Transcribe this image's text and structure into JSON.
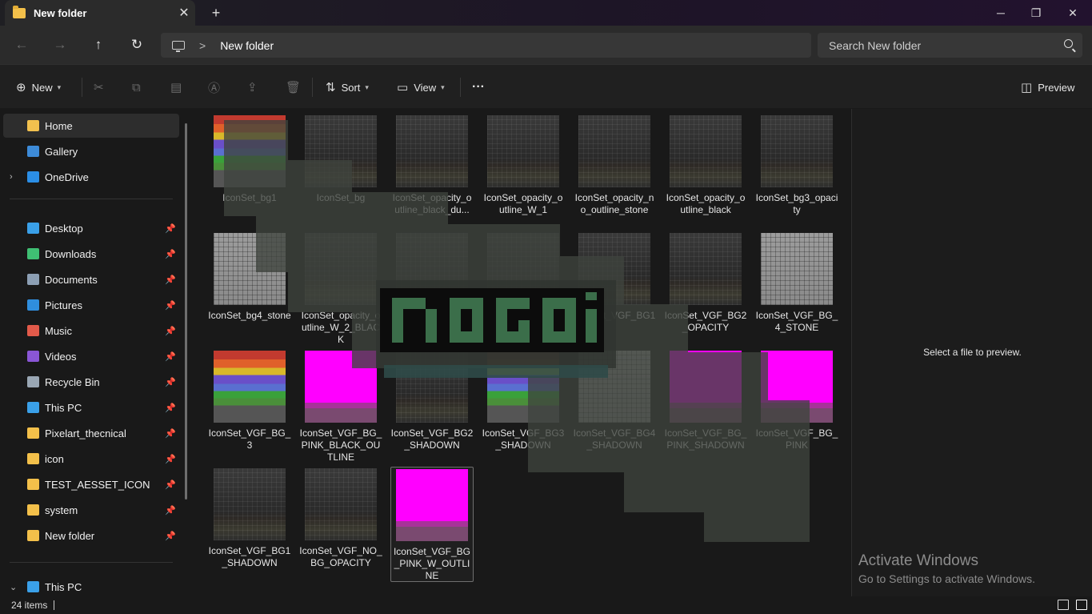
{
  "window": {
    "tab_title": "New folder",
    "tab_close": "✕",
    "new_tab": "+",
    "minimize": "─",
    "maximize": "❐",
    "close": "✕"
  },
  "nav": {
    "back": "←",
    "forward": "→",
    "up": "↑",
    "refresh": "↻",
    "separator": ">",
    "breadcrumb": "New folder",
    "search_placeholder": "Search New folder"
  },
  "toolbar": {
    "new_label": "New",
    "sort_label": "Sort",
    "view_label": "View",
    "more": "···",
    "preview_label": "Preview"
  },
  "sidebar": {
    "items": [
      {
        "label": "Home",
        "icon": "home-icon",
        "color": "#f2c14e"
      },
      {
        "label": "Gallery",
        "icon": "gallery-icon",
        "color": "#3d8bd8"
      },
      {
        "label": "OneDrive",
        "icon": "cloud-icon",
        "color": "#2b8ee6"
      },
      {
        "label": "Desktop",
        "icon": "desktop-icon",
        "color": "#3aa0e8"
      },
      {
        "label": "Downloads",
        "icon": "download-icon",
        "color": "#3fbf73"
      },
      {
        "label": "Documents",
        "icon": "document-icon",
        "color": "#8c9fb4"
      },
      {
        "label": "Pictures",
        "icon": "pictures-icon",
        "color": "#2f8ede"
      },
      {
        "label": "Music",
        "icon": "music-icon",
        "color": "#e25a4a"
      },
      {
        "label": "Videos",
        "icon": "videos-icon",
        "color": "#8a56d6"
      },
      {
        "label": "Recycle Bin",
        "icon": "recycle-bin-icon",
        "color": "#9aa7b4"
      },
      {
        "label": "This PC",
        "icon": "pc-icon",
        "color": "#3aa0e8"
      },
      {
        "label": "Pixelart_thecnical",
        "icon": "folder-icon",
        "color": "#f3c04a"
      },
      {
        "label": "icon",
        "icon": "folder-icon",
        "color": "#f3c04a"
      },
      {
        "label": "TEST_AESSET_ICON",
        "icon": "folder-icon",
        "color": "#f3c04a"
      },
      {
        "label": "system",
        "icon": "folder-icon",
        "color": "#f3c04a"
      },
      {
        "label": "New folder",
        "icon": "folder-icon",
        "color": "#f3c04a"
      },
      {
        "label": "This PC",
        "icon": "pc-icon",
        "color": "#3aa0e8"
      }
    ]
  },
  "files": [
    {
      "name": "IconSet_bg1",
      "thumb": "rainbow"
    },
    {
      "name": "IconSet_bg",
      "thumb": "dark"
    },
    {
      "name": "IconSet_opacity_outline_black_du...",
      "thumb": "dark"
    },
    {
      "name": "IconSet_opacity_outline_W_1",
      "thumb": "dark"
    },
    {
      "name": "IconSet_opacity_no_outline_stone",
      "thumb": "dark"
    },
    {
      "name": "IconSet_opacity_outline_black",
      "thumb": "dark"
    },
    {
      "name": "IconSet_bg3_opacity",
      "thumb": "dark"
    },
    {
      "name": "IconSet_bg4_stone",
      "thumb": "gray"
    },
    {
      "name": "IconSet_opacity_outline_W_2_BLACK",
      "thumb": "dark"
    },
    {
      "name": "",
      "thumb": "dark"
    },
    {
      "name": "",
      "thumb": "dark"
    },
    {
      "name": "IconSet_VGF_BG1",
      "thumb": "dark"
    },
    {
      "name": "IconSet_VGF_BG2_OPACITY",
      "thumb": "dark"
    },
    {
      "name": "IconSet_VGF_BG_4_STONE",
      "thumb": "gray"
    },
    {
      "name": "IconSet_VGF_BG_3",
      "thumb": "rainbow"
    },
    {
      "name": "IconSet_VGF_BG_PINK_BLACK_OUTLINE",
      "thumb": "pink"
    },
    {
      "name": "IconSet_VGF_BG2_SHADOWN",
      "thumb": "dark"
    },
    {
      "name": "IconSet_VGF_BG3_SHADOWN",
      "thumb": "rainbow"
    },
    {
      "name": "IconSet_VGF_BG4_SHADOWN",
      "thumb": "gray"
    },
    {
      "name": "IconSet_VGF_BG_PINK_SHADOWN",
      "thumb": "pink"
    },
    {
      "name": "IconSet_VGF_BG_PINK",
      "thumb": "pink"
    },
    {
      "name": "IconSet_VGF_BG1_SHADOWN",
      "thumb": "dark"
    },
    {
      "name": "IconSet_VGF_NO_BG_OPACITY",
      "thumb": "dark"
    },
    {
      "name": "IconSet_VGF_BG_PINK_W_OUTLINE",
      "thumb": "pink"
    }
  ],
  "preview": {
    "message": "Select a file to preview."
  },
  "watermark": {
    "activate_title": "Activate Windows",
    "activate_sub": "Go to Settings to activate Windows."
  },
  "status": {
    "item_count": "24 items"
  }
}
